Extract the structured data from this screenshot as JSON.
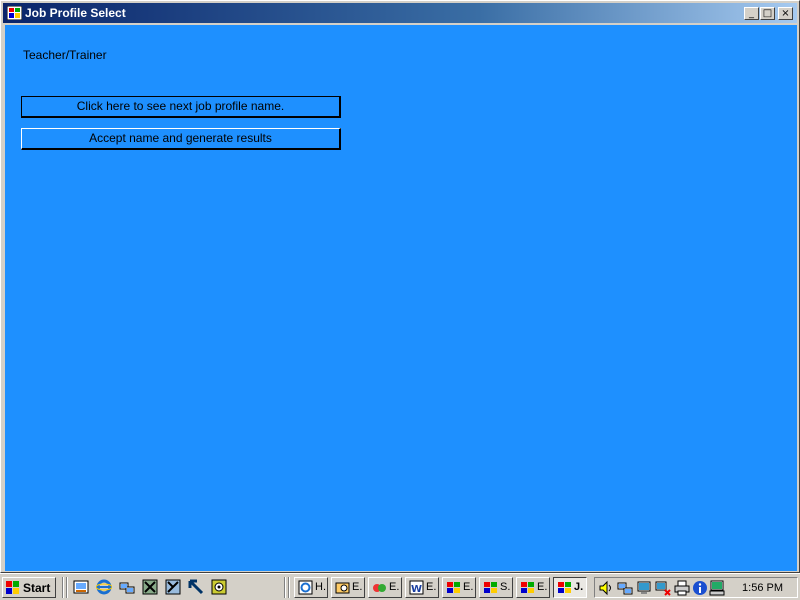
{
  "window": {
    "title": "Job Profile Select",
    "title_icon": "app-windows-icon",
    "controls": {
      "minimize": "minimize-icon",
      "maximize": "maximize-icon",
      "close": "close-icon"
    },
    "client_color": "#1e90ff"
  },
  "content": {
    "profile_name": "Teacher/Trainer",
    "next_button_label": "Click here to see next job profile name.",
    "accept_button_label": "Accept name and generate results"
  },
  "taskbar": {
    "start_label": "Start",
    "quick_launch": [
      "show-desktop-icon",
      "internet-explorer-icon",
      "network-icon",
      "app-icon",
      "app-icon",
      "cursor-tool-icon",
      "media-icon"
    ],
    "tasks": [
      {
        "label": "H.",
        "icon": "ie-window-icon",
        "active": false
      },
      {
        "label": "E.",
        "icon": "explorer-icon",
        "active": false
      },
      {
        "label": "E.",
        "icon": "paint-icon",
        "active": false
      },
      {
        "label": "E.",
        "icon": "word-icon",
        "active": false
      },
      {
        "label": "E.",
        "icon": "app-windows-icon",
        "active": false
      },
      {
        "label": "S.",
        "icon": "app-windows-icon",
        "active": false
      },
      {
        "label": "E.",
        "icon": "app-windows-icon",
        "active": false
      },
      {
        "label": "J.",
        "icon": "app-windows-icon",
        "active": true
      }
    ],
    "tray_icons": [
      "volume-icon",
      "network-connections-icon",
      "network-status-icon",
      "network-disconnected-icon",
      "printer-icon",
      "info-icon",
      "computer-icon"
    ],
    "clock": "1:56 PM"
  }
}
